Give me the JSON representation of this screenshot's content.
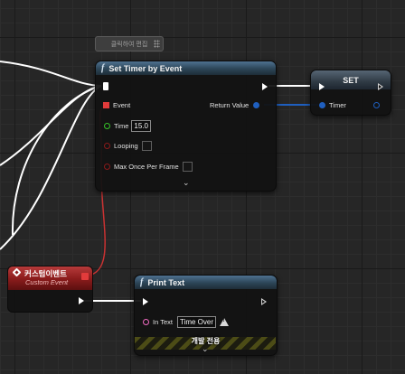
{
  "comment_bubble": {
    "text": "클릭하여 편집"
  },
  "set_timer_node": {
    "title": "Set Timer by Event",
    "pins": {
      "event": "Event",
      "time": "Time",
      "time_value": "15.0",
      "looping": "Looping",
      "max_once": "Max Once Per Frame",
      "return_value": "Return Value"
    }
  },
  "set_node": {
    "title": "SET",
    "timer": "Timer"
  },
  "custom_event_node": {
    "title": "커스텀이벤트",
    "subtitle": "Custom Event"
  },
  "print_text_node": {
    "title": "Print Text",
    "in_text_label": "In Text",
    "in_text_value": "Time Over",
    "dev_only_banner": "개발 전용"
  },
  "colors": {
    "exec_wire": "#ffffff",
    "delegate_wire": "#c93232",
    "object_wire": "#1f5fbf",
    "bool_pin": "#8c1a1a",
    "float_pin": "#37c628",
    "string_pin": "#f26bc3"
  },
  "icons": {
    "function": "function-f-icon",
    "event": "custom-event-diamond-icon",
    "warning": "warning-triangle-icon",
    "expand": "chevron-down-icon"
  }
}
